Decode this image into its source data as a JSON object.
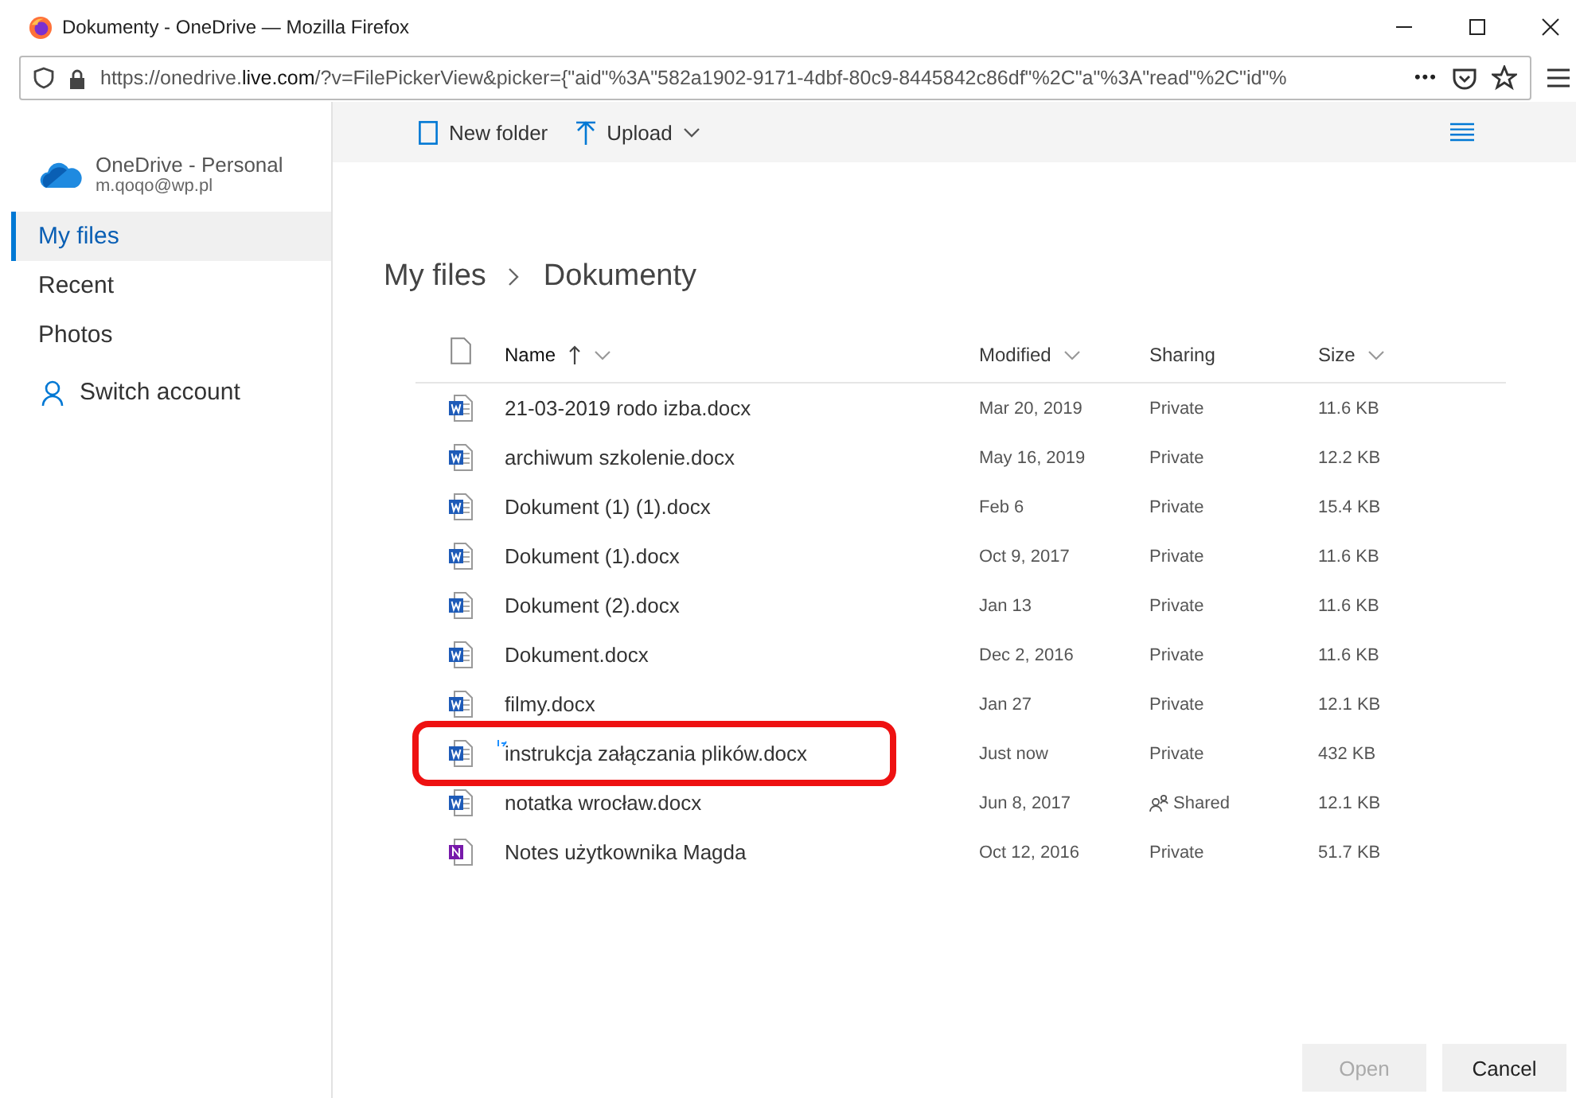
{
  "window": {
    "title": "Dokumenty - OneDrive — Mozilla Firefox"
  },
  "address_bar": {
    "url_start": "https://onedrive.",
    "url_domain": "live.com",
    "url_rest": "/?v=FilePickerView&picker={\"aid\"%3A\"582a1902-9171-4dbf-80c9-8445842c86df\"%2C\"a\"%3A\"read\"%2C\"id\"%",
    "more": "•••"
  },
  "account": {
    "name": "OneDrive - Personal",
    "email": "m.qoqo@wp.pl"
  },
  "sidebar": {
    "items": [
      {
        "label": "My files",
        "selected": true
      },
      {
        "label": "Recent",
        "selected": false
      },
      {
        "label": "Photos",
        "selected": false
      }
    ],
    "switch_account": "Switch account"
  },
  "toolbar": {
    "new_folder": "New folder",
    "upload": "Upload"
  },
  "breadcrumb": [
    "My files",
    "Dokumenty"
  ],
  "table": {
    "columns": [
      {
        "label": "Name",
        "sorted": true
      },
      {
        "label": "Modified",
        "sorted": false
      },
      {
        "label": "Sharing",
        "sorted": false
      },
      {
        "label": "Size",
        "sorted": false
      }
    ],
    "rows": [
      {
        "kind": "word",
        "name": "21-03-2019 rodo izba.docx",
        "modified": "Mar 20, 2019",
        "sharing": "Private",
        "shared": false,
        "size": "11.6 KB",
        "new": false,
        "highlight": false
      },
      {
        "kind": "word",
        "name": "archiwum szkolenie.docx",
        "modified": "May 16, 2019",
        "sharing": "Private",
        "shared": false,
        "size": "12.2 KB",
        "new": false,
        "highlight": false
      },
      {
        "kind": "word",
        "name": "Dokument (1) (1).docx",
        "modified": "Feb 6",
        "sharing": "Private",
        "shared": false,
        "size": "15.4 KB",
        "new": false,
        "highlight": false
      },
      {
        "kind": "word",
        "name": "Dokument (1).docx",
        "modified": "Oct 9, 2017",
        "sharing": "Private",
        "shared": false,
        "size": "11.6 KB",
        "new": false,
        "highlight": false
      },
      {
        "kind": "word",
        "name": "Dokument (2).docx",
        "modified": "Jan 13",
        "sharing": "Private",
        "shared": false,
        "size": "11.6 KB",
        "new": false,
        "highlight": false
      },
      {
        "kind": "word",
        "name": "Dokument.docx",
        "modified": "Dec 2, 2016",
        "sharing": "Private",
        "shared": false,
        "size": "11.6 KB",
        "new": false,
        "highlight": false
      },
      {
        "kind": "word",
        "name": "filmy.docx",
        "modified": "Jan 27",
        "sharing": "Private",
        "shared": false,
        "size": "12.1 KB",
        "new": false,
        "highlight": false
      },
      {
        "kind": "word",
        "name": "instrukcja załączania plików.docx",
        "modified": "Just now",
        "sharing": "Private",
        "shared": false,
        "size": "432 KB",
        "new": true,
        "highlight": true
      },
      {
        "kind": "word",
        "name": "notatka wrocław.docx",
        "modified": "Jun 8, 2017",
        "sharing": "Shared",
        "shared": true,
        "size": "12.1 KB",
        "new": false,
        "highlight": false
      },
      {
        "kind": "onenote",
        "name": "Notes użytkownika Magda",
        "modified": "Oct 12, 2016",
        "sharing": "Private",
        "shared": false,
        "size": "51.7 KB",
        "new": false,
        "highlight": false
      }
    ]
  },
  "buttons": [
    {
      "label": "Open",
      "disabled": true
    },
    {
      "label": "Cancel",
      "disabled": false
    }
  ]
}
